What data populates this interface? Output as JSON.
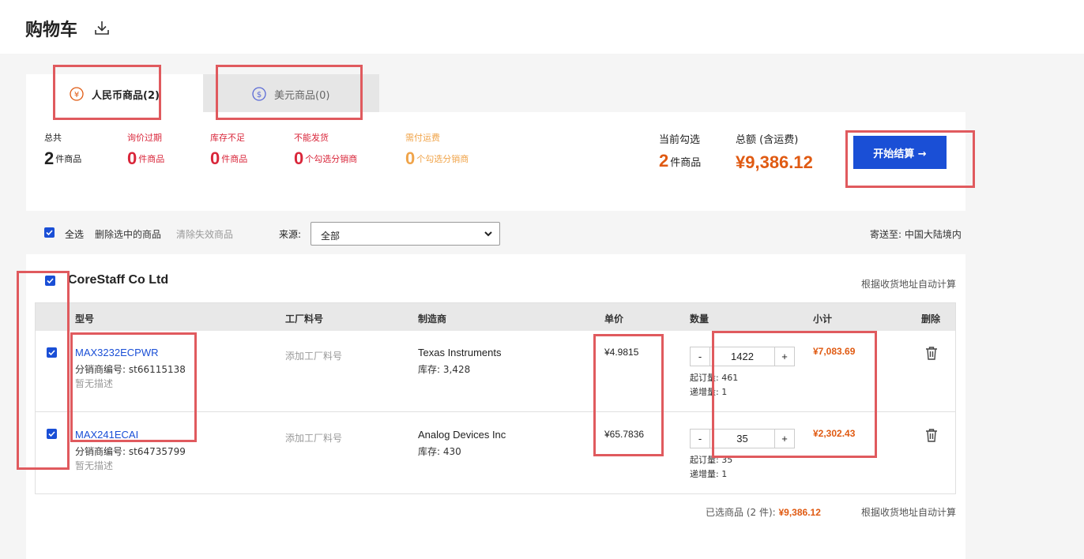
{
  "page": {
    "title": "购物车",
    "download_icon": "download-icon"
  },
  "tabs": [
    {
      "label": "人民币商品(2)",
      "icon": "yuan-icon",
      "active": true,
      "color": "#e05a12"
    },
    {
      "label": "美元商品(0)",
      "icon": "dollar-icon",
      "active": false,
      "color": "#5a6ad6"
    }
  ],
  "summary": {
    "total": {
      "label": "总共",
      "value": "2",
      "unit": "件商品"
    },
    "expired": {
      "label": "询价过期",
      "value": "0",
      "unit": "件商品"
    },
    "low_stock": {
      "label": "库存不足",
      "value": "0",
      "unit": "件商品"
    },
    "no_ship": {
      "label": "不能发货",
      "value": "0",
      "unit": "个勾选分销商"
    },
    "freight": {
      "label": "需付运费",
      "value": "0",
      "unit": "个勾选分销商"
    },
    "selected": {
      "label": "当前勾选",
      "value": "2",
      "unit": "件商品"
    },
    "total_amount": {
      "label": "总额 (含运费)",
      "value": "¥9,386.12"
    },
    "checkout_label": "开始结算 →"
  },
  "toolbar": {
    "select_all": "全选",
    "delete_selected": "删除选中的商品",
    "clear_invalid": "清除失效商品",
    "source_label": "来源:",
    "source_value": "全部",
    "ship_to": "寄送至: 中国大陆境内"
  },
  "vendor": {
    "name": "CoreStaff Co Ltd",
    "auto_calc": "根据收货地址自动计算"
  },
  "table": {
    "headers": [
      "型号",
      "工厂料号",
      "制造商",
      "单价",
      "数量",
      "小计",
      "删除"
    ],
    "rows": [
      {
        "part": "MAX3232ECPWR",
        "dist_no": "分销商编号: st66115138",
        "desc": "暂无描述",
        "factory": "添加工厂料号",
        "mfr": "Texas Instruments",
        "stock": "库存: 3,428",
        "price": "¥4.9815",
        "qty": "1422",
        "moq": "起订量: 461",
        "inc": "递增量: 1",
        "subtotal": "¥7,083.69"
      },
      {
        "part": "MAX241ECAI",
        "dist_no": "分销商编号: st64735799",
        "desc": "暂无描述",
        "factory": "添加工厂料号",
        "mfr": "Analog Devices Inc",
        "stock": "库存: 430",
        "price": "¥65.7836",
        "qty": "35",
        "moq": "起订量: 35",
        "inc": "递增量: 1",
        "subtotal": "¥2,302.43"
      }
    ]
  },
  "footer": {
    "selected_label": "已选商品 (2 件): ",
    "selected_amount": "¥9,386.12",
    "auto_calc": "根据收货地址自动计算"
  },
  "colors": {
    "accent": "#1a4fd6",
    "price": "#e05a12",
    "alert": "#d9263a",
    "highlight": "#e05a5e"
  }
}
